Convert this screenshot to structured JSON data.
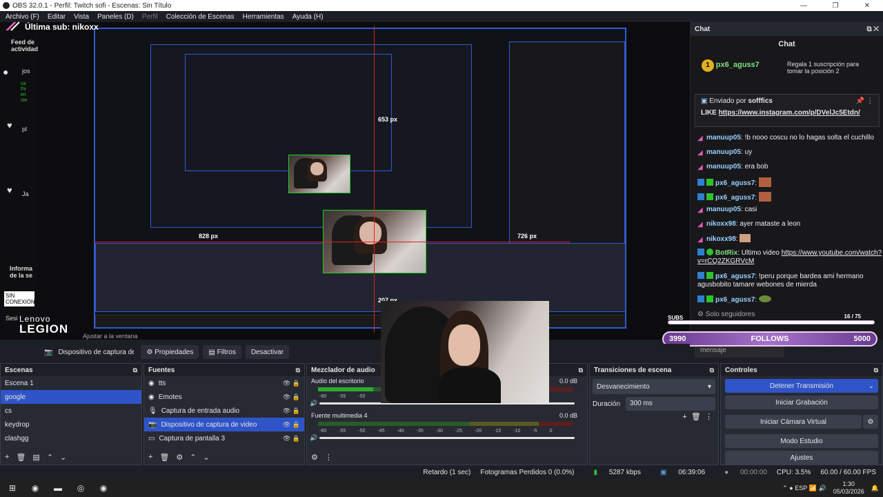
{
  "window": {
    "title": "OBS 32.0.1 - Perfil: Twitch sofi - Escenas: Sin Título"
  },
  "menu": {
    "items": [
      "Archivo (F)",
      "Editar",
      "Vista",
      "Paneles (D)",
      "Perfil",
      "Colección de Escenas",
      "Herramientas",
      "Ayuda (H)"
    ]
  },
  "overlay": {
    "last_sub": "Última sub: nikoxx",
    "watermark_l1": "Lenovo",
    "watermark_l2": "LEGION",
    "dim_h": "828 px",
    "dim_v": "653 px",
    "dim_small_h": "726 px",
    "dim_bottom": "207 px"
  },
  "left_strip": {
    "feed": "Feed de actividad",
    "items": [
      "jos",
      "pl",
      "Ja",
      "Informa de la se"
    ],
    "sin_conexion": "SIN CONEXIÓN",
    "sesion": "Sesi"
  },
  "chat": {
    "dock_title": "Chat",
    "header": "Chat",
    "gift_user": "px6_aguss7",
    "gift_text": "Regala 1 suscripción para tomar la posición 2",
    "pinned_by": "Enviado por",
    "pinned_user": "sofffics",
    "pinned_text": "LIKE",
    "pinned_link": "https://www.instagram.com/p/DVelJc5Etdn/",
    "messages": [
      {
        "user": "manuup05",
        "text": "!b nooo coscu no lo hagas solta el cuchillo",
        "color": "#9ad1ff"
      },
      {
        "user": "manuup05",
        "text": "uy",
        "color": "#9ad1ff"
      },
      {
        "user": "manuup05",
        "text": "era bob",
        "color": "#9ad1ff"
      },
      {
        "user": "px6_aguss7",
        "text": "",
        "color": "#9ad1ff"
      },
      {
        "user": "px6_aguss7",
        "text": "",
        "color": "#9ad1ff"
      },
      {
        "user": "manuup05",
        "text": "casi",
        "color": "#9ad1ff"
      },
      {
        "user": "nikoxx98",
        "text": "ayer mataste a leon",
        "color": "#9ad1ff"
      },
      {
        "user": "nikoxx98",
        "text": "",
        "color": "#9ad1ff"
      },
      {
        "user": "BotRix",
        "text": "Ultimo video",
        "color": "#7ee07e"
      },
      {
        "user": "px6_aguss7",
        "text": "!peru porque bardea ami hermano",
        "color": "#9ad1ff"
      },
      {
        "user": "px6_aguss7",
        "text": "",
        "color": "#9ad1ff"
      }
    ],
    "botrix_link": "https://www.youtube.com/watch?",
    "botrix_link2": "v=rCQ2ZKGRVcM",
    "px6_cont": "agusbobito tamare webones de mierda",
    "solo_seguidores": "Solo seguidores",
    "input_placeholder": "mensaje",
    "send_label": "Chat"
  },
  "goals": {
    "subs_label": "SUBS",
    "subs_count": "16",
    "subs_total": "75",
    "follows_left": "3990",
    "follows_label": "FOLLOWS",
    "follows_right": "5000"
  },
  "source_bar": {
    "source_name": "Dispositivo de captura de v",
    "properties": "Propiedades",
    "filters": "Filtros",
    "deactivate": "Desactivar",
    "adjust": "Ajustar a la ventana"
  },
  "scenes": {
    "title": "Escenas",
    "items": [
      "Escena 1",
      "google",
      "cs",
      "keydrop",
      "clashgg"
    ],
    "selected": 1
  },
  "sources": {
    "title": "Fuentes",
    "items": [
      "tts",
      "Emotes",
      "Captura de entrada audio",
      "Dispositivo de captura de video",
      "Captura de pantalla 3"
    ],
    "selected": 3
  },
  "mixer": {
    "title": "Mezclador de audio",
    "channels": [
      {
        "name": "Audio del escritorio",
        "db": "0.0 dB",
        "level": 0.4
      },
      {
        "name": "Fuente multimedia 4",
        "db": "0.0 dB",
        "level": 0.0
      }
    ],
    "scale": [
      "-60",
      "-55",
      "-50",
      "-45",
      "-40",
      "-35",
      "-30",
      "-25",
      "-20",
      "-15",
      "-10",
      "-5",
      "0"
    ]
  },
  "transitions": {
    "title": "Transiciones de escena",
    "transition": "Desvanecimiento",
    "duration_label": "Duración",
    "duration_value": "300 ms"
  },
  "controls": {
    "title": "Controles",
    "stop_stream": "Detener Transmisión",
    "start_recording": "Iniciar Grabación",
    "start_virtual_cam": "Iniciar Cámara Virtual",
    "studio_mode": "Modo Estudio",
    "settings": "Ajustes"
  },
  "status": {
    "delay": "Retardo (1 sec)",
    "dropped": "Fotogramas Perdidos 0 (0.0%)",
    "kbps": "5287 kbps",
    "stream_time": "06:39:06",
    "rec_time": "00:00:00",
    "cpu": "CPU: 3.5%",
    "fps": "60.00 / 60.00 FPS"
  },
  "taskbar": {
    "lang": "ESP",
    "time": "1:30",
    "date": "05/03/2026"
  },
  "colors": {
    "accent": "#2f54c8",
    "twitch": "#9147ff",
    "red_guide": "#e02020",
    "green_select": "#20d020"
  }
}
